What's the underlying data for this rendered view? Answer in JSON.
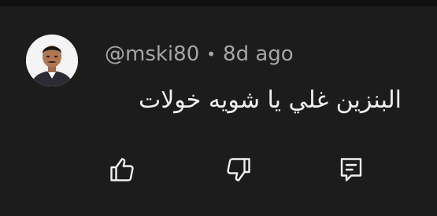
{
  "comment": {
    "author": "@mski80",
    "separator": "•",
    "age": "8d ago",
    "text": "البنزين غلي يا شويه خولات"
  },
  "actions": {
    "like_icon": "thumbs-up-icon",
    "dislike_icon": "thumbs-down-icon",
    "reply_icon": "reply-comment-icon"
  },
  "colors": {
    "background": "#1c1c1c",
    "topbar": "#0f0f0f",
    "meta_text": "#a6a6a6",
    "body_text": "#f1f1f1",
    "icon": "#f1f1f1"
  }
}
